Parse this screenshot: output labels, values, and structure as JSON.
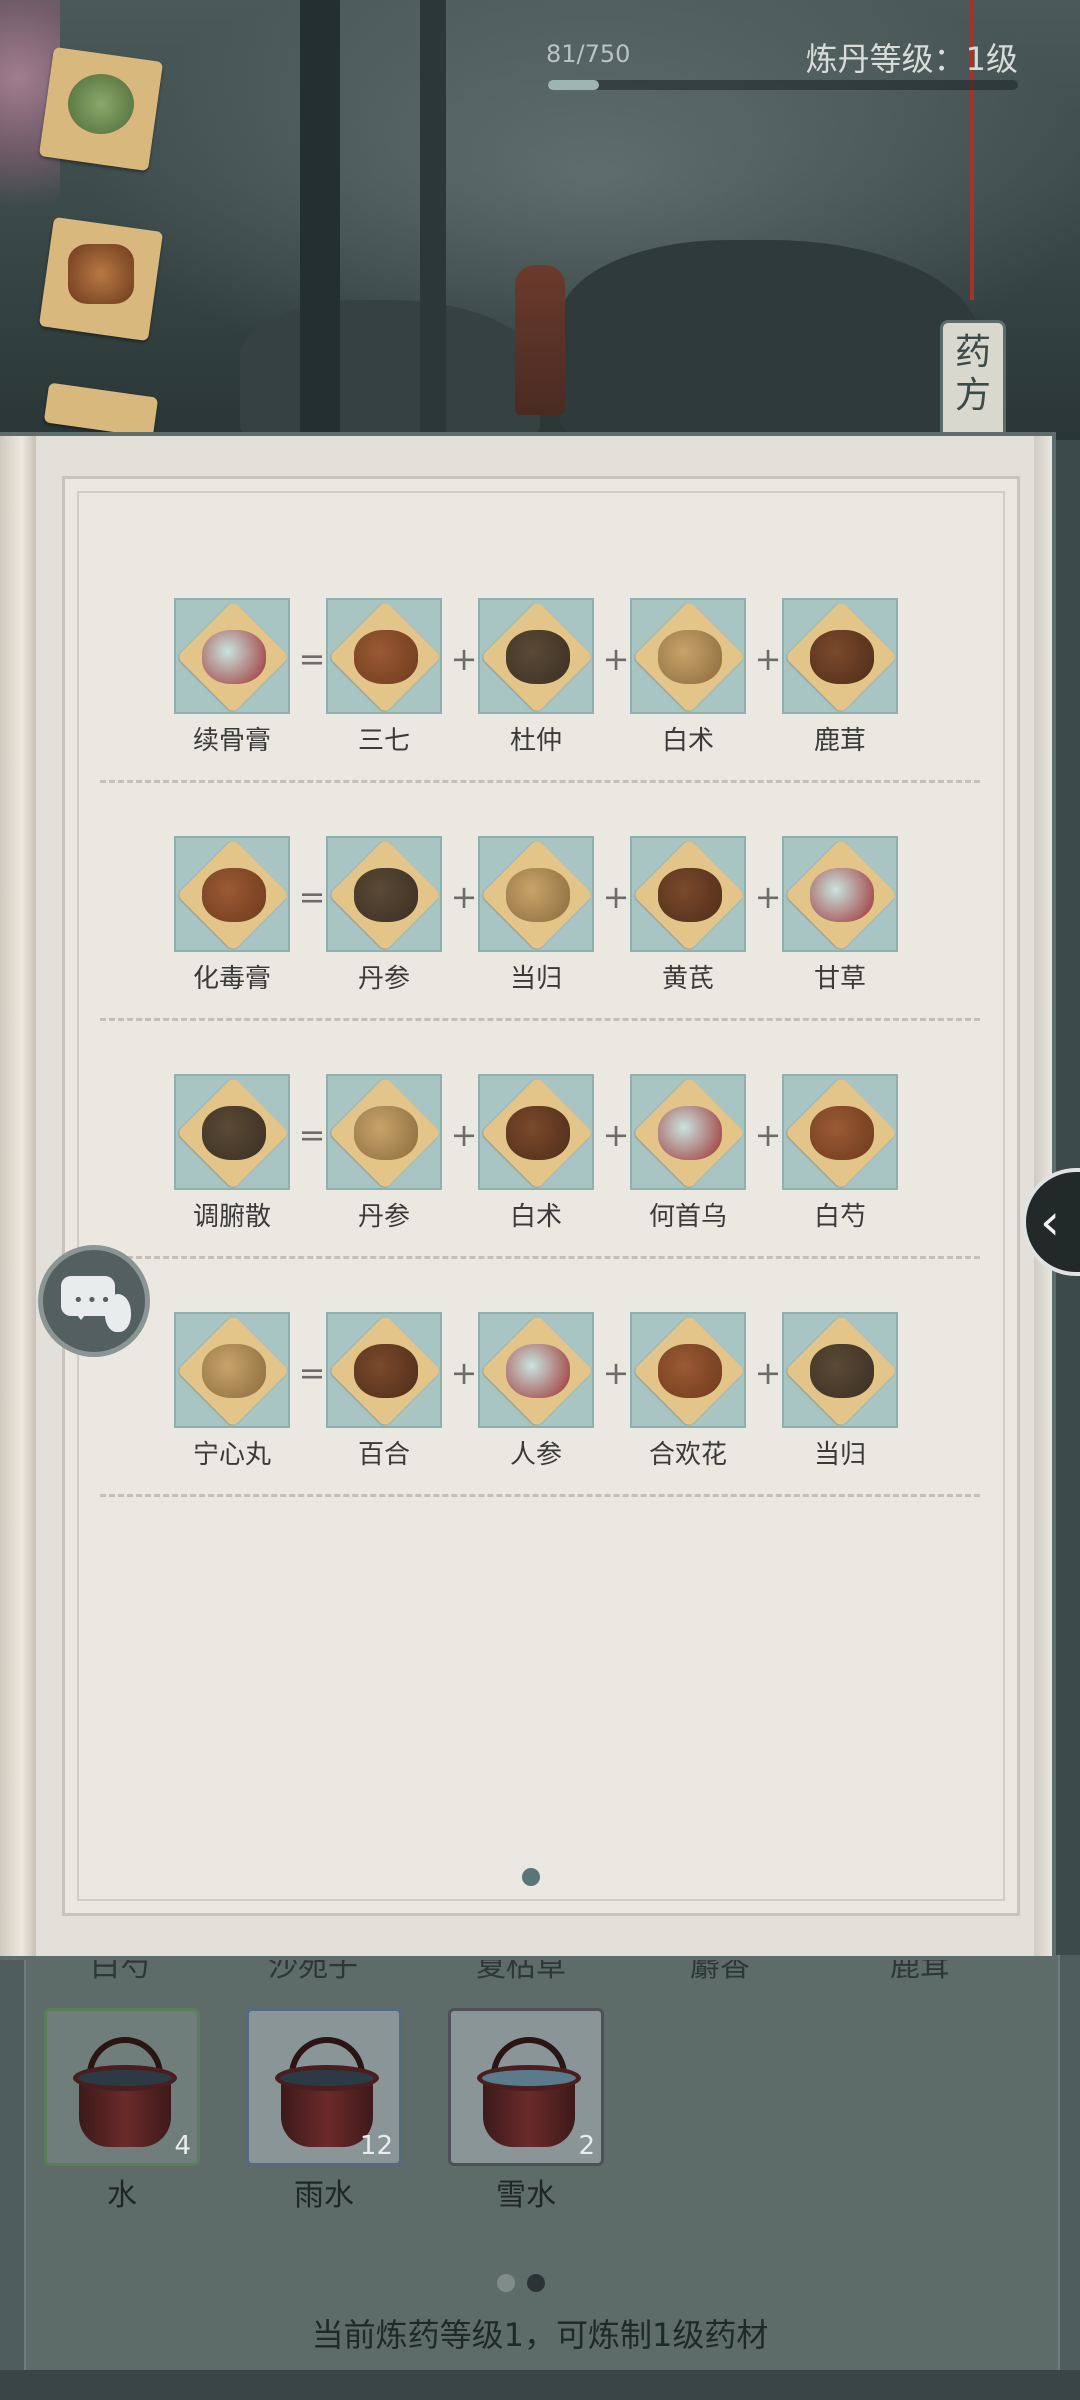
{
  "header": {
    "exp_text": "81/750",
    "exp_progress": 0.108,
    "level_text": "炼丹等级：1级"
  },
  "recipe_tab": {
    "label_1": "药",
    "label_2": "方"
  },
  "recipes": [
    {
      "result": "续骨膏",
      "ingredients": [
        "三七",
        "杜仲",
        "白术",
        "鹿茸"
      ]
    },
    {
      "result": "化毒膏",
      "ingredients": [
        "丹参",
        "当归",
        "黄芪",
        "甘草"
      ]
    },
    {
      "result": "调腑散",
      "ingredients": [
        "丹参",
        "白术",
        "何首乌",
        "白芍"
      ]
    },
    {
      "result": "宁心丸",
      "ingredients": [
        "百合",
        "人参",
        "合欢花",
        "当归"
      ]
    }
  ],
  "operators": {
    "equals": "=",
    "plus": "+"
  },
  "lower_panel": {
    "header_labels": [
      "白芍",
      "沙苑子",
      "夏枯草",
      "麝香",
      "鹿茸"
    ],
    "water_items": [
      {
        "label": "水",
        "count": "4"
      },
      {
        "label": "雨水",
        "count": "12"
      },
      {
        "label": "雪水",
        "count": "2"
      }
    ],
    "status_text": "当前炼药等级1，可炼制1级药材"
  },
  "icons": {
    "chat": "chat-bubble-gourd-icon",
    "side_arrow": "chevron-left-icon"
  }
}
